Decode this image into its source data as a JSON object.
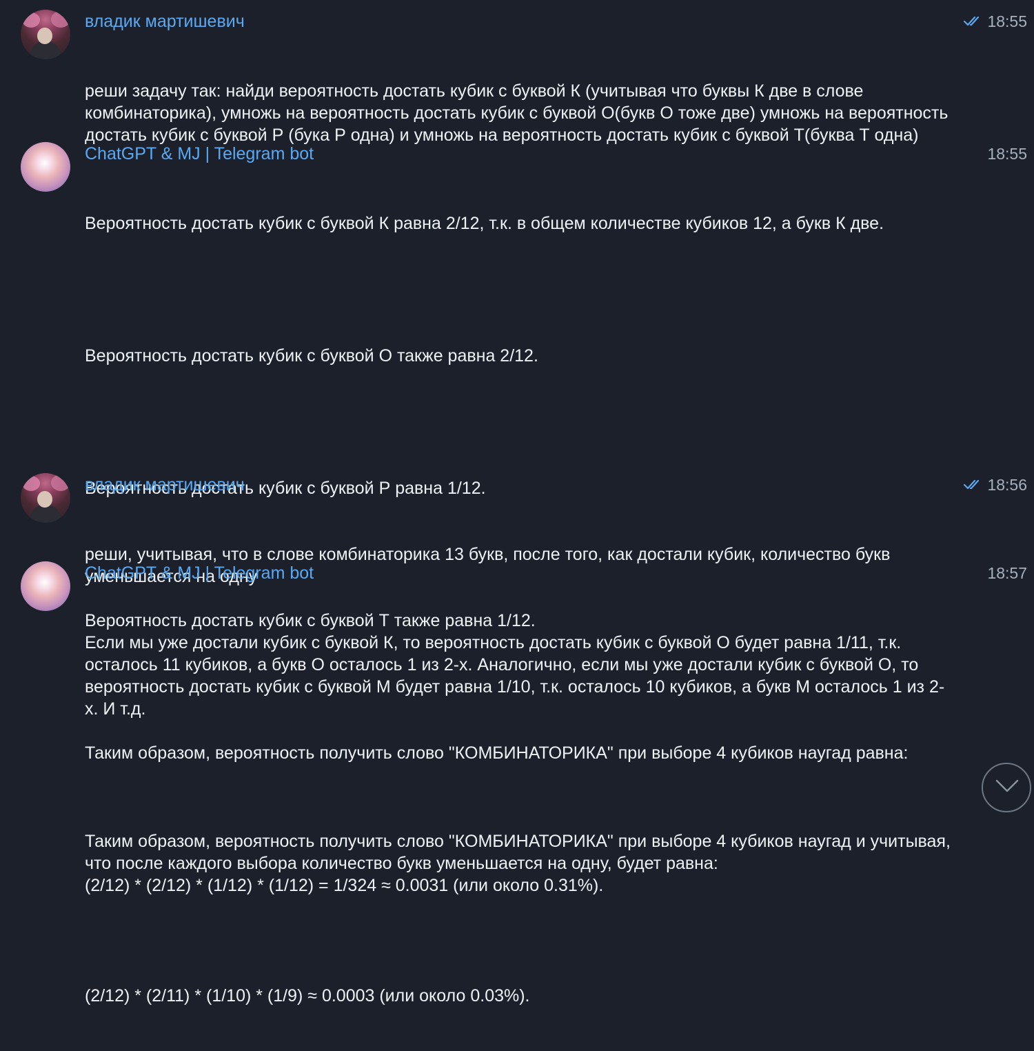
{
  "messages": [
    {
      "sender": "владик мартишевич",
      "time": "18:55",
      "read": true,
      "paragraphs": [
        "реши задачу так: найди вероятность достать кубик с буквой К (учитывая что буквы К две в слове комбинаторика), умножь на вероятность достать кубик с буквой О(букв О тоже две) умножь на вероятность достать кубик с буквой Р (бука Р одна) и умножь на вероятность достать кубик с буквой Т(буква Т одна)"
      ]
    },
    {
      "sender": "ChatGPT & MJ | Telegram bot",
      "time": "18:55",
      "read": false,
      "paragraphs": [
        "Вероятность достать кубик с буквой К равна 2/12, т.к. в общем количестве кубиков 12, а букв К две.",
        "Вероятность достать кубик с буквой О также равна 2/12.",
        "Вероятность достать кубик с буквой Р равна 1/12.",
        "Вероятность достать кубик с буквой Т также равна 1/12.",
        "Таким образом, вероятность получить слово \"КОМБИНАТОРИКА\" при выборе 4 кубиков наугад равна:",
        "(2/12) * (2/12) * (1/12) * (1/12) = 1/324 ≈ 0.0031 (или около 0.31%)."
      ]
    },
    {
      "sender": "владик мартишевич",
      "time": "18:56",
      "read": true,
      "paragraphs": [
        "реши, учитывая, что в слове комбинаторика 13 букв, после того, как достали кубик, количество букв уменьшается на одну"
      ]
    },
    {
      "sender": "ChatGPT & MJ | Telegram bot",
      "time": "18:57",
      "read": false,
      "paragraphs": [
        "Если мы уже достали кубик с буквой К, то вероятность достать кубик с буквой О будет равна 1/11, т.к. осталось 11 кубиков, а букв О осталось 1 из 2-х. Аналогично, если мы уже достали кубик с буквой О, то вероятность достать кубик с буквой М будет равна 1/10, т.к. осталось 10 кубиков, а букв М осталось 1 из 2-х. И т.д.",
        "Таким образом, вероятность получить слово \"КОМБИНАТОРИКА\" при выборе 4 кубиков наугад и учитывая, что после каждого выбора количество букв уменьшается на одну, будет равна:",
        "(2/12) * (2/11) * (1/10) * (1/9) ≈ 0.0003 (или около 0.03%)."
      ]
    }
  ],
  "colors": {
    "background": "#1b202a",
    "sender_name": "#5aa9f2",
    "text": "#eef1f5",
    "time": "#a7b0bc",
    "read_check": "#5aa9f2"
  },
  "icons": {
    "read_status": "double-check-icon",
    "scroll_down": "chevron-down-icon"
  }
}
